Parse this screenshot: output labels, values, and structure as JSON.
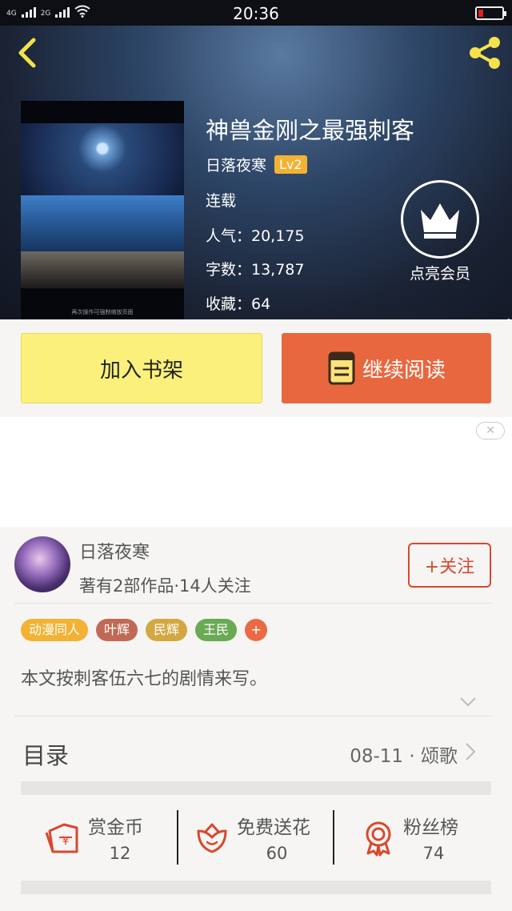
{
  "status_bar": {
    "time": "20:36",
    "signal_1_label": "4G",
    "signal_2_label": "2G",
    "battery_color": "#e02020"
  },
  "header": {
    "back_icon": "chevron-left-icon",
    "share_icon": "share-icon"
  },
  "book": {
    "cover_caption": "再次操作可强制缩放页面",
    "title": "神兽金刚之最强刺客",
    "author": "日落夜寒",
    "level": "Lv2",
    "status": "连载",
    "popularity": "人气：20,175",
    "word_count": "字数：13,787",
    "favorites": "收藏：64"
  },
  "vip": {
    "label": "点亮会员",
    "icon": "crown-icon"
  },
  "actions": {
    "add_shelf": "加入书架",
    "continue_read": "继续阅读",
    "shelf_color": "#fbf07b",
    "read_color": "#e9673e"
  },
  "ad": {
    "close_glyph": "✕"
  },
  "author_info": {
    "name": "日落夜寒",
    "stats": "著有2部作品·14人关注",
    "follow": "+关注"
  },
  "tags": [
    {
      "label": "动漫同人",
      "color": "#f3b233"
    },
    {
      "label": "叶辉",
      "color": "#c06a55"
    },
    {
      "label": "民辉",
      "color": "#d3a843"
    },
    {
      "label": "王民",
      "color": "#6aaa55"
    }
  ],
  "tag_add": "+",
  "summary": "本文按刺客伍六七的剧情来写。",
  "catalog": {
    "title": "目录",
    "latest": "08-11 · 颂歌"
  },
  "stats": [
    {
      "label": "赏金币",
      "value": "12",
      "icon": "reward-coin-icon"
    },
    {
      "label": "免费送花",
      "value": "60",
      "icon": "flower-icon"
    },
    {
      "label": "粉丝榜",
      "value": "74",
      "icon": "medal-icon"
    }
  ],
  "accent_color": "#d9482e"
}
